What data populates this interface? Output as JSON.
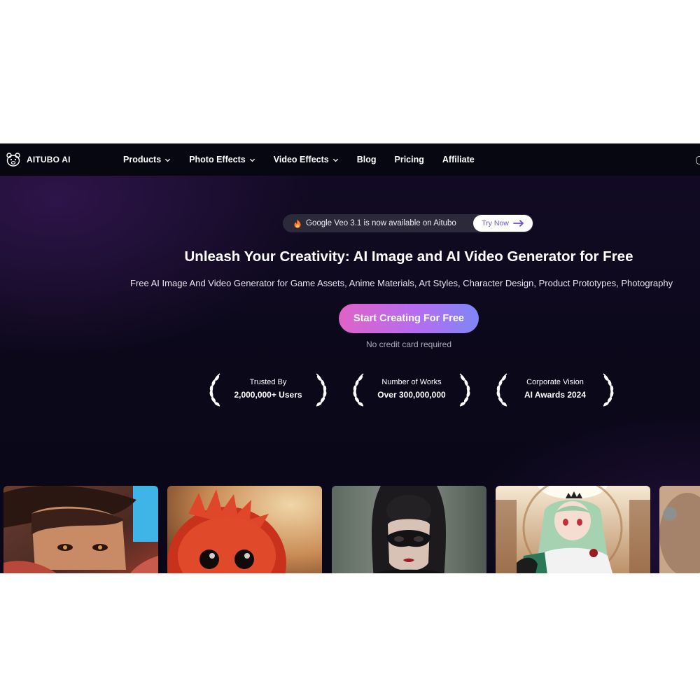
{
  "brand": {
    "name": "AITUBO AI",
    "logo_icon": "bear-logo-icon"
  },
  "nav": {
    "items": [
      {
        "label": "Products",
        "has_dropdown": true
      },
      {
        "label": "Photo Effects",
        "has_dropdown": true
      },
      {
        "label": "Video Effects",
        "has_dropdown": true
      },
      {
        "label": "Blog",
        "has_dropdown": false
      },
      {
        "label": "Pricing",
        "has_dropdown": false
      },
      {
        "label": "Affiliate",
        "has_dropdown": false
      }
    ]
  },
  "announcement": {
    "icon": "fire-icon",
    "text": "Google Veo 3.1 is now available on Aitubo",
    "button_label": "Try Now",
    "button_icon": "arrow-right-icon"
  },
  "hero": {
    "title": "Unleash Your Creativity: AI Image and AI Video Generator for Free",
    "subtitle": "Free AI Image And Video Generator for Game Assets, Anime Materials, Art Styles, Character Design, Product Prototypes, Photography",
    "cta_label": "Start Creating For Free",
    "cta_note": "No credit card required"
  },
  "awards": [
    {
      "line1": "Trusted By",
      "line2": "2,000,000+ Users"
    },
    {
      "line1": "Number of Works",
      "line2": "Over 300,000,000"
    },
    {
      "line1": "Corporate Vision",
      "line2": "AI Awards 2024"
    }
  ],
  "gallery": [
    {
      "subject": "anime-boy-brown-hair"
    },
    {
      "subject": "red-fluffy-creature"
    },
    {
      "subject": "woman-lace-mask"
    },
    {
      "subject": "anime-girl-green-hair-tiara"
    },
    {
      "subject": "partial-image"
    }
  ],
  "colors": {
    "background": "#0b0819",
    "nav_background": "#070712",
    "announcement_background": "#2c2a3a",
    "accent_purple": "#6b4fd8",
    "cta_gradient_start": "#e062c8",
    "cta_gradient_end": "#7f86f6"
  }
}
